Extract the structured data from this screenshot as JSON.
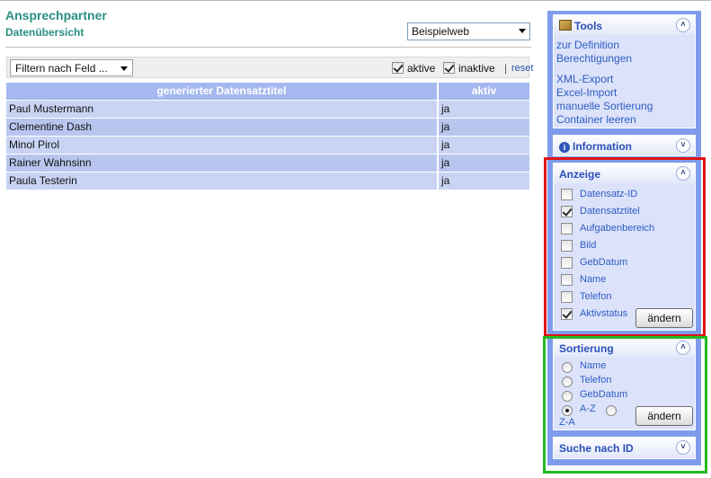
{
  "header": {
    "title": "Ansprechpartner",
    "subtitle": "Datenübersicht",
    "web_select": "Beispielweb"
  },
  "filterbar": {
    "filter_select": "Filtern nach Feld ...",
    "aktiv_label": "aktive",
    "aktiv_checked": true,
    "inaktiv_label": "inaktive",
    "inaktiv_checked": true,
    "separator": "|",
    "reset_label": "reset"
  },
  "table": {
    "columns": [
      "generierter Datensatztitel",
      "aktiv"
    ],
    "rows": [
      {
        "title": "Paul Mustermann",
        "aktiv": "ja"
      },
      {
        "title": "Clementine Dash",
        "aktiv": "ja"
      },
      {
        "title": "Minol Pirol",
        "aktiv": "ja"
      },
      {
        "title": "Rainer Wahnsinn",
        "aktiv": "ja"
      },
      {
        "title": "Paula Testerin",
        "aktiv": "ja"
      }
    ]
  },
  "sidebar": {
    "tools": {
      "title": "Tools",
      "icon": "tools-icon",
      "toggle": "collapse-icon",
      "links_group1": [
        "zur Definition",
        "Berechtigungen"
      ],
      "links_group2": [
        "XML-Export",
        "Excel-Import",
        "manuelle Sortierung",
        "Container leeren"
      ]
    },
    "information": {
      "title": "Information",
      "icon": "info-icon",
      "toggle": "expand-icon"
    },
    "anzeige": {
      "title": "Anzeige",
      "toggle": "collapse-icon",
      "options": [
        {
          "label": "Datensatz-ID",
          "checked": false
        },
        {
          "label": "Datensatztitel",
          "checked": true
        },
        {
          "label": "Aufgabenbereich",
          "checked": false
        },
        {
          "label": "Bild",
          "checked": false
        },
        {
          "label": "GebDatum",
          "checked": false
        },
        {
          "label": "Name",
          "checked": false
        },
        {
          "label": "Telefon",
          "checked": false
        },
        {
          "label": "Aktivstatus",
          "checked": true
        }
      ],
      "button": "ändern"
    },
    "sortierung": {
      "title": "Sortierung",
      "toggle": "collapse-icon",
      "options": [
        {
          "label": "Name",
          "checked": false
        },
        {
          "label": "Telefon",
          "checked": false
        },
        {
          "label": "GebDatum",
          "checked": false
        },
        {
          "label": "A-Z",
          "checked": true
        }
      ],
      "za_label": "Z-A",
      "za_checked": false,
      "button": "ändern"
    },
    "suche": {
      "title": "Suche nach ID",
      "toggle": "expand-icon"
    }
  },
  "colors": {
    "title_green": "#2a9080",
    "sidebar_blue": "#7f9cec",
    "link_blue": "#2e5cc4",
    "highlight_red": "#e01515",
    "highlight_green": "#22bb22"
  }
}
